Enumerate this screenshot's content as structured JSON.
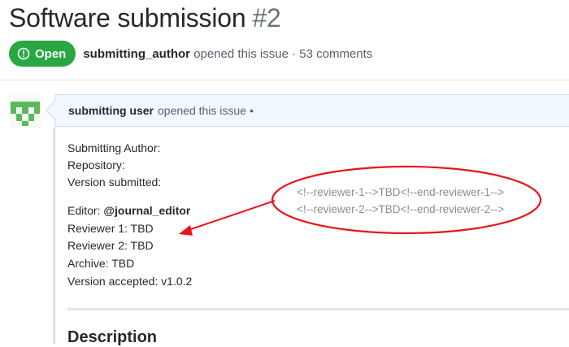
{
  "issue": {
    "title": "Software submission",
    "number": "#2",
    "state": "Open",
    "author": "submitting_author",
    "opened_text": "opened this issue · 53 comments"
  },
  "comment": {
    "author": "submitting user",
    "action": "opened this issue",
    "dot": "•",
    "lines": {
      "submitting_author": "Submitting Author:",
      "repository": "Repository:",
      "version_submitted": "Version submitted:",
      "editor_label": "Editor: ",
      "editor_value": "@journal_editor",
      "reviewer1": "Reviewer 1: TBD",
      "reviewer2": "Reviewer 2: TBD",
      "archive": "Archive: TBD",
      "version_accepted": "Version accepted: v1.0.2"
    },
    "description_heading": "Description"
  },
  "annotation": {
    "line1": "<!--reviewer-1-->TBD<!--end-reviewer-1-->",
    "line2": "<!--reviewer-2-->TBD<!--end-reviewer-2-->",
    "color": "#e8141b"
  },
  "colors": {
    "open_badge": "#28a745",
    "comment_header_bg": "#f1f8ff",
    "avatar": "#5cb85c"
  },
  "icons": {
    "state": "issue-opened-icon",
    "avatar": "identicon-avatar"
  }
}
